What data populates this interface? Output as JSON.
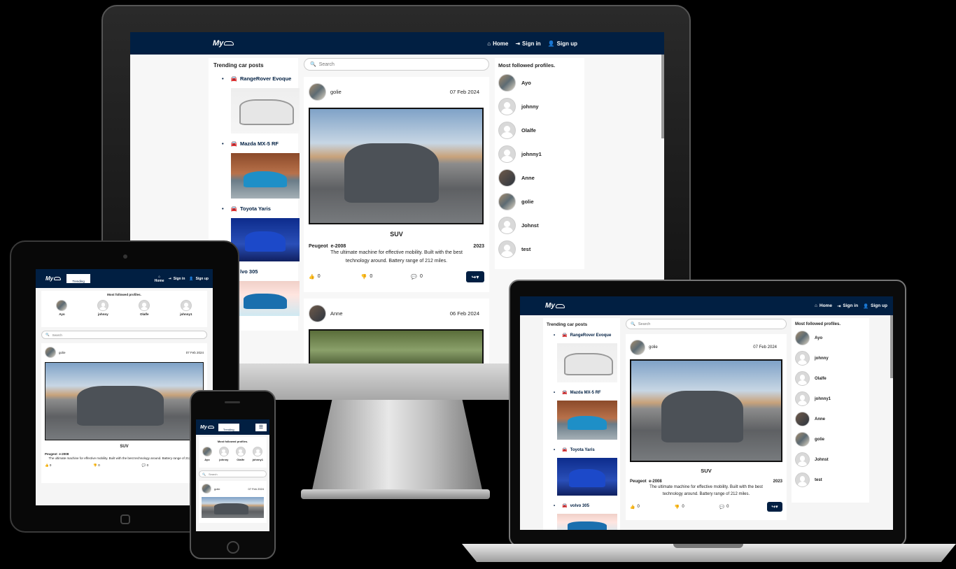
{
  "brand": {
    "logo": "My"
  },
  "nav": {
    "home": "Home",
    "signin": "Sign in",
    "signup": "Sign up",
    "trending": "Trending"
  },
  "sidebar": {
    "title": "Trending car posts",
    "items": [
      {
        "label": "RangeRover Evoque"
      },
      {
        "label": "Mazda MX-5 RF"
      },
      {
        "label": "Toyota Yaris"
      },
      {
        "label": "volvo 305"
      }
    ],
    "partial_volvo": "lvo 305"
  },
  "search": {
    "placeholder": "Search"
  },
  "posts": [
    {
      "author": "golie",
      "date": "07 Feb 2024",
      "category": "SUV",
      "make": "Peugeot",
      "model": "e-2008",
      "year": "2023",
      "description": "The ultimate machine for effective mobility. Built with the best technology around. Battery range of 212 miles.",
      "likes": "0",
      "dislikes": "0",
      "comments": "0"
    },
    {
      "author": "Anne",
      "date": "06 Feb 2024"
    }
  ],
  "profiles": {
    "title": "Most followed profiles.",
    "items": [
      {
        "name": "Ayo"
      },
      {
        "name": "johnny"
      },
      {
        "name": "Olalfe"
      },
      {
        "name": "johnny1"
      },
      {
        "name": "Anne"
      },
      {
        "name": "golie"
      },
      {
        "name": "Johnst"
      },
      {
        "name": "test"
      }
    ]
  },
  "colors": {
    "navy": "#011f42",
    "background": "#000000",
    "page": "#ffffff"
  }
}
